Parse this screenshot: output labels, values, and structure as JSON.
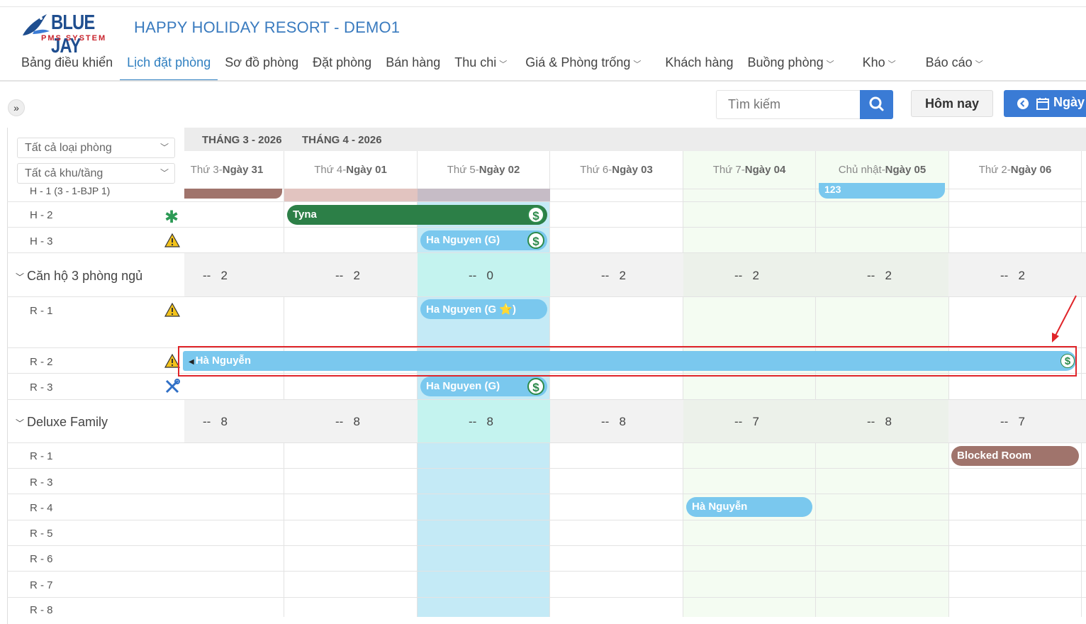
{
  "app": {
    "logo_text": "BLUE JAY",
    "logo_subtext": "PMS SYSTEM",
    "title": "HAPPY HOLIDAY RESORT - DEMO1"
  },
  "nav": [
    {
      "label": "Bảng điều khiển",
      "active": false,
      "dropdown": false
    },
    {
      "label": "Lịch đặt phòng",
      "active": true,
      "dropdown": false
    },
    {
      "label": "Sơ đồ phòng",
      "active": false,
      "dropdown": false
    },
    {
      "label": "Đặt phòng",
      "active": false,
      "dropdown": false
    },
    {
      "label": "Bán hàng",
      "active": false,
      "dropdown": false
    },
    {
      "label": "Thu chi",
      "active": false,
      "dropdown": true
    },
    {
      "label": "Giá & Phòng trống",
      "active": false,
      "dropdown": true
    },
    {
      "label": "Khách hàng",
      "active": false,
      "dropdown": false
    },
    {
      "label": "Buồng phòng",
      "active": false,
      "dropdown": true
    },
    {
      "label": "Kho",
      "active": false,
      "dropdown": true
    },
    {
      "label": "Báo cáo",
      "active": false,
      "dropdown": true
    }
  ],
  "toolbar": {
    "expand_label": "»",
    "search_placeholder": "Tìm kiếm",
    "today_label": "Hôm nay",
    "day_label": "Ngày"
  },
  "filters": {
    "room_type": "Tất cả loại phòng",
    "area_floor": "Tất cả khu/tầng"
  },
  "months": [
    "THÁNG 3 - 2026",
    "THÁNG 4 - 2026"
  ],
  "days": [
    {
      "weekday": "Thứ 3",
      "date": "Ngày 31"
    },
    {
      "weekday": "Thứ 4",
      "date": "Ngày 01"
    },
    {
      "weekday": "Thứ 5",
      "date": "Ngày 02"
    },
    {
      "weekday": "Thứ 6",
      "date": "Ngày 03"
    },
    {
      "weekday": "Thứ 7",
      "date": "Ngày 04"
    },
    {
      "weekday": "Chủ nhật",
      "date": "Ngày 05"
    },
    {
      "weekday": "Thứ 2",
      "date": "Ngày 06"
    }
  ],
  "rooms_top": [
    {
      "label": "H - 1 (3 - 1-BJP 1)"
    },
    {
      "label": "H - 2",
      "icon": "asterisk-icon"
    },
    {
      "label": "H - 3",
      "icon": "warning-icon"
    }
  ],
  "group1": {
    "name": "Căn hộ 3 phòng ngủ",
    "availability": [
      "--   2",
      "--   2",
      "--   0",
      "--   2",
      "--   2",
      "--   2",
      "--   2"
    ],
    "rooms": [
      {
        "label": "R - 1",
        "icon": "warning-icon"
      },
      {
        "label": "R - 2",
        "icon": "warning-icon"
      },
      {
        "label": "R - 3",
        "icon": "tools-icon"
      }
    ]
  },
  "group2": {
    "name": "Deluxe Family",
    "availability": [
      "--   8",
      "--   8",
      "--   8",
      "--   8",
      "--   7",
      "--   8",
      "--   7"
    ],
    "rooms": [
      "R - 1",
      "R - 3",
      "R - 4",
      "R - 5",
      "R - 6",
      "R - 7",
      "R - 8"
    ]
  },
  "bookings": {
    "h1_partial": "123",
    "h2": "Tyna",
    "h3": "Ha Nguyen (G)",
    "r1": "Ha Nguyen (G ⭐)",
    "r2": "Hà Nguyễn",
    "r3": "Ha Nguyen (G)",
    "df_blocked": "Blocked Room",
    "df_r4": "Hà Nguyễn",
    "dollar_symbol": "$"
  },
  "colors": {
    "accent": "#2f7fc0",
    "booking_blue": "#7ac8ee",
    "booking_green": "#2c7f47",
    "booking_blocked": "#a0746c",
    "highlight_red": "#e0252a"
  }
}
